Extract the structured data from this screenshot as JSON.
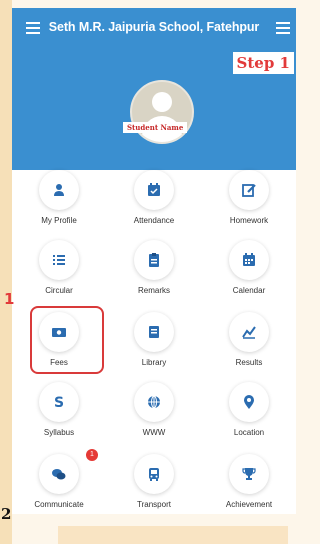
{
  "app": {
    "title": "Seth M.R. Jaipuria School, Fatehpur"
  },
  "annotations": {
    "step": "Step 1",
    "marker_one": "1",
    "marker_two": "2"
  },
  "profile": {
    "student_name": "Student Name"
  },
  "menu": [
    {
      "label": "My Profile",
      "icon": "person-icon"
    },
    {
      "label": "Attendance",
      "icon": "calendar-check-icon"
    },
    {
      "label": "Homework",
      "icon": "edit-icon"
    },
    {
      "label": "Circular",
      "icon": "list-icon"
    },
    {
      "label": "Remarks",
      "icon": "clipboard-icon"
    },
    {
      "label": "Calendar",
      "icon": "calendar-icon"
    },
    {
      "label": "Fees",
      "icon": "money-icon"
    },
    {
      "label": "Library",
      "icon": "book-icon"
    },
    {
      "label": "Results",
      "icon": "chart-icon"
    },
    {
      "label": "Syllabus",
      "icon": "syllabus-s-icon"
    },
    {
      "label": "WWW",
      "icon": "globe-icon"
    },
    {
      "label": "Location",
      "icon": "location-pin-icon"
    },
    {
      "label": "Communicate",
      "icon": "chat-icon",
      "badge": "1"
    },
    {
      "label": "Transport",
      "icon": "bus-icon"
    },
    {
      "label": "Achievement",
      "icon": "trophy-icon"
    }
  ],
  "colors": {
    "header": "#3a8fd0",
    "icon": "#2b6cb0",
    "annotation": "#e23a3a"
  }
}
